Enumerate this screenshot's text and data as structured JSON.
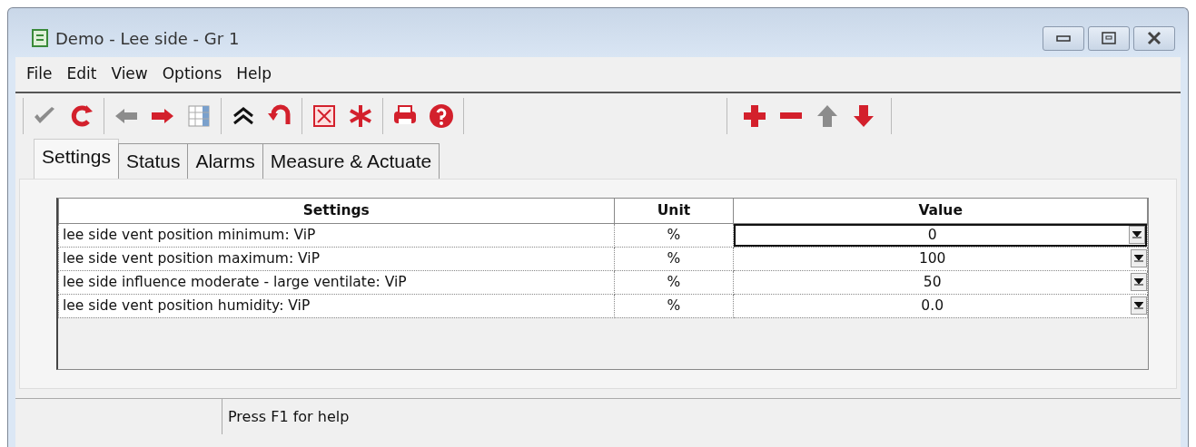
{
  "window": {
    "title": "Demo - Lee side - Gr 1"
  },
  "menu": [
    "File",
    "Edit",
    "View",
    "Options",
    "Help"
  ],
  "toolbar": [
    [
      {
        "kind": "check",
        "disabled": true
      },
      {
        "kind": "refresh",
        "disabled": false
      }
    ],
    [
      {
        "kind": "left",
        "disabled": true
      },
      {
        "kind": "right",
        "disabled": false
      },
      {
        "kind": "grid"
      }
    ],
    [
      {
        "kind": "collapse"
      },
      {
        "kind": "undo",
        "disabled": false
      }
    ],
    [
      {
        "kind": "xbox",
        "disabled": false
      },
      {
        "kind": "asterisk",
        "disabled": false
      }
    ],
    [
      {
        "kind": "print",
        "disabled": false
      },
      {
        "kind": "help",
        "disabled": false
      }
    ]
  ],
  "toolbar_right": [
    {
      "kind": "plus",
      "disabled": false
    },
    {
      "kind": "minus",
      "disabled": false
    },
    {
      "kind": "up",
      "disabled": true
    },
    {
      "kind": "down",
      "disabled": false
    }
  ],
  "tabs": [
    {
      "label": "Settings",
      "selected": true
    },
    {
      "label": "Status",
      "selected": false
    },
    {
      "label": "Alarms",
      "selected": false
    },
    {
      "label": "Measure & Actuate",
      "selected": false
    }
  ],
  "table": {
    "columns": [
      "Settings",
      "Unit",
      "Value"
    ],
    "rows": [
      {
        "setting": "lee side vent position minimum: ViP",
        "unit": "%",
        "value": "0",
        "selected": true
      },
      {
        "setting": "lee side vent position maximum: ViP",
        "unit": "%",
        "value": "100",
        "selected": false
      },
      {
        "setting": "lee side influence moderate - large ventilate: ViP",
        "unit": "%",
        "value": "50",
        "selected": false
      },
      {
        "setting": "lee side vent position humidity: ViP",
        "unit": "%",
        "value": "0.0",
        "selected": false
      }
    ]
  },
  "status_bar": {
    "message": "Press F1 for help"
  }
}
